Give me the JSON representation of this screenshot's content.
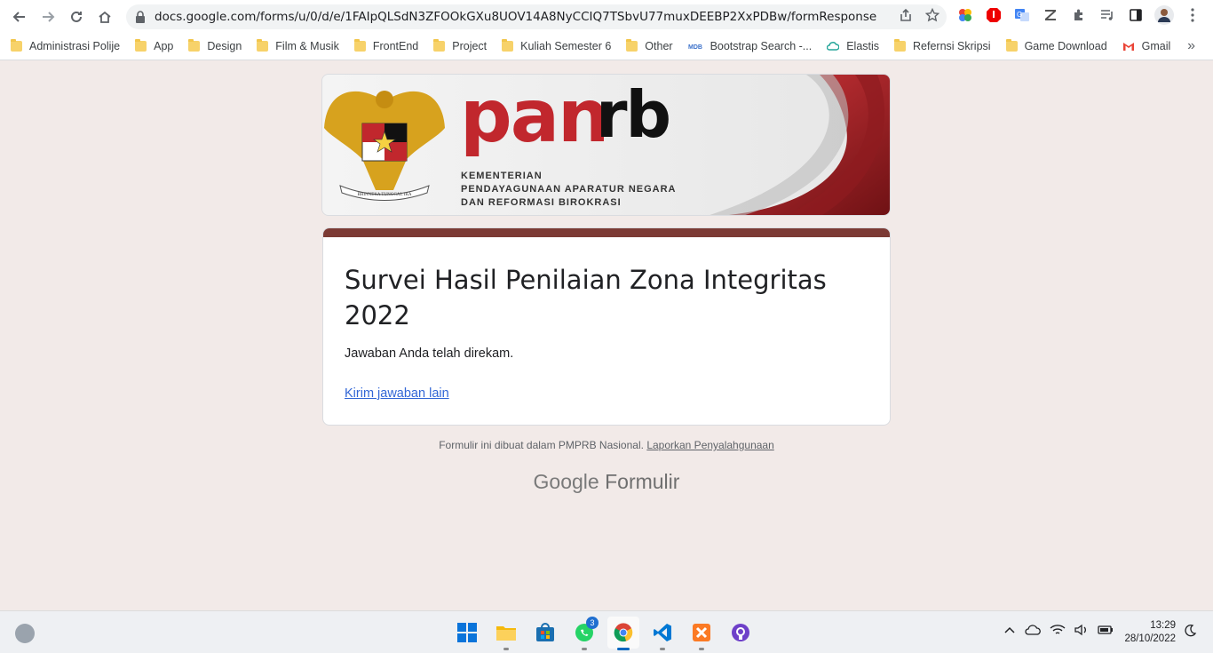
{
  "browser": {
    "url": "docs.google.com/forms/u/0/d/e/1FAIpQLSdN3ZFOOkGXu8UOV14A8NyCCIQ7TSbvU77muxDEEBP2XxPDBw/formResponse",
    "bookmarks": [
      {
        "label": "Administrasi Polije",
        "icon": "folder-icon"
      },
      {
        "label": "App",
        "icon": "folder-icon"
      },
      {
        "label": "Design",
        "icon": "folder-icon"
      },
      {
        "label": "Film & Musik",
        "icon": "folder-icon"
      },
      {
        "label": "FrontEnd",
        "icon": "folder-icon"
      },
      {
        "label": "Project",
        "icon": "folder-icon"
      },
      {
        "label": "Kuliah Semester 6",
        "icon": "folder-icon"
      },
      {
        "label": "Other",
        "icon": "folder-icon"
      },
      {
        "label": "Bootstrap Search -...",
        "icon": "mdb-icon"
      },
      {
        "label": "Elastis",
        "icon": "cloud-icon"
      },
      {
        "label": "Refernsi Skripsi",
        "icon": "folder-icon"
      },
      {
        "label": "Game Download",
        "icon": "folder-icon"
      },
      {
        "label": "Gmail",
        "icon": "gmail-icon"
      }
    ]
  },
  "header": {
    "brand_pan": "pan",
    "brand_rb": "rb",
    "ministry_line1": "KEMENTERIAN",
    "ministry_line2": "PENDAYAGUNAAN APARATUR NEGARA",
    "ministry_line3": "DAN REFORMASI BIROKRASI",
    "emblem_motto": "BHINNEKA TUNGGAL IKA"
  },
  "form": {
    "title": "Survei Hasil Penilaian Zona Integritas 2022",
    "confirmation": "Jawaban Anda telah direkam.",
    "another_response": "Kirim jawaban lain"
  },
  "footer": {
    "note": "Formulir ini dibuat dalam PMPRB Nasional.",
    "report_link": "Laporkan Penyalahgunaan",
    "logo_google": "Google",
    "logo_forms": "Formulir"
  },
  "taskbar": {
    "whatsapp_badge": "3",
    "time": "13:29",
    "date": "28/10/2022"
  },
  "colors": {
    "accent": "#7c3a34",
    "background": "#f2eae8",
    "link": "#3367d6",
    "brand_red": "#c1272d"
  }
}
